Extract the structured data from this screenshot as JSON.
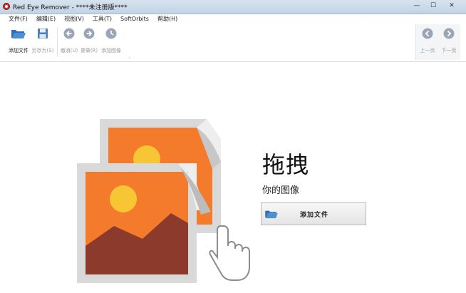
{
  "window": {
    "title": "Red Eye Remover - ****未注册版****",
    "minimize_glyph": "—",
    "maximize_glyph": "☐",
    "close_glyph": "✕"
  },
  "menu": {
    "items": [
      {
        "label": "文件(F)"
      },
      {
        "label": "编辑(E)"
      },
      {
        "label": "视图(V)"
      },
      {
        "label": "工具(T)"
      },
      {
        "label": "SoftOrbits"
      },
      {
        "label": "帮助(H)"
      }
    ]
  },
  "toolbar": {
    "add_file_label": "添加文件",
    "save_as_label": "另存为(S)",
    "undo_label": "撤消(U)",
    "redo_label": "重做(R)",
    "add_image_label": "添加图像",
    "prev_page_label": "上一页",
    "next_page_label": "下一页",
    "icons": {
      "add_file": "folder-open-icon",
      "save_as": "floppy-disk-icon",
      "undo": "undo-arrow-icon",
      "redo": "redo-arrow-icon",
      "add_image": "clock-history-icon",
      "prev_page": "left-arrow-icon",
      "next_page": "right-arrow-icon"
    }
  },
  "dropzone": {
    "title": "拖拽",
    "subtitle": "你的图像",
    "add_button_label": "添加文件",
    "illustration_colors": {
      "frame": "#d9d9d9",
      "orange": "#f47a2c",
      "sun": "#f7c634",
      "mountain": "#8b3a2b"
    }
  }
}
